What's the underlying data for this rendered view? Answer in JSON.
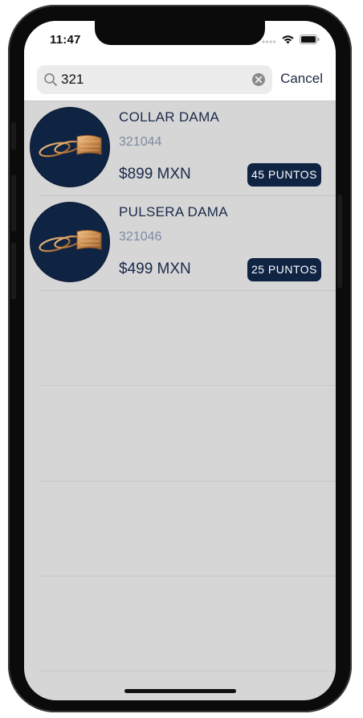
{
  "status_bar": {
    "time": "11:47",
    "icons": [
      "signal-dots-icon",
      "wifi-icon",
      "battery-icon"
    ]
  },
  "search": {
    "value": "321",
    "placeholder": "",
    "cancel_label": "Cancel"
  },
  "colors": {
    "navy": "#0f2343",
    "background": "#d6d6d6",
    "code_gray": "#7d8aa3"
  },
  "results": [
    {
      "name": "COLLAR DAMA",
      "code": "321044",
      "price": "$899 MXN",
      "points": "45 PUNTOS",
      "image": "gold-rings-icon"
    },
    {
      "name": "PULSERA DAMA",
      "code": "321046",
      "price": "$499 MXN",
      "points": "25 PUNTOS",
      "image": "gold-rings-icon"
    }
  ]
}
